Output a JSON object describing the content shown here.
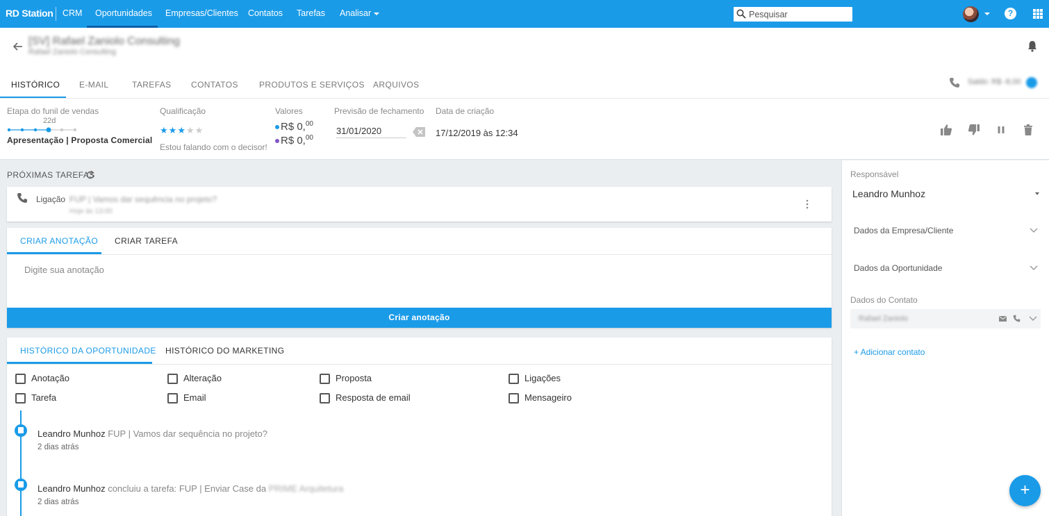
{
  "topbar": {
    "brand": "RD Station",
    "product": "CRM",
    "nav": [
      "Oportunidades",
      "Empresas/Clientes",
      "Contatos",
      "Tarefas",
      "Analisar"
    ],
    "search_placeholder": "Pesquisar",
    "help_label": "?"
  },
  "deal": {
    "title": "[SV] Rafael Zaniolo Consulting",
    "subtitle": "Rafael Zaniolo Consulting"
  },
  "tabs": [
    "HISTÓRICO",
    "E-MAIL",
    "TAREFAS",
    "CONTATOS",
    "PRODUTOS E SERVIÇOS",
    "ARQUIVOS"
  ],
  "saldo": "Saldo: R$ -8,00",
  "summary": {
    "stage_label": "Etapa do funil de vendas",
    "stage_days": "22d",
    "stage_name": "Apresentação | Proposta Comercial",
    "funnel_current_step": 4,
    "funnel_total_steps": 6,
    "qualification_label": "Qualificação",
    "rating": 3,
    "rating_max": 5,
    "qualification_text": "Estou falando com o decisor!",
    "values_label": "Valores",
    "value_one_main": "R$ 0,",
    "value_one_cents": "00",
    "value_two_main": "R$ 0,",
    "value_two_cents": "00",
    "forecast_label": "Previsão de fechamento",
    "forecast_value": "31/01/2020",
    "created_label": "Data de criação",
    "created_value": "17/12/2019 às 12:34"
  },
  "next_tasks": {
    "title": "PRÓXIMAS TAREFAS",
    "task_type": "Ligação",
    "task_text": "FUP | Vamos dar sequência no projeto?",
    "task_sub": "Hoje às 13:00"
  },
  "note": {
    "tab_note": "CRIAR ANOTAÇÃO",
    "tab_task": "CRIAR TAREFA",
    "placeholder": "Digite sua anotação",
    "button": "Criar anotação"
  },
  "history": {
    "tab_deal": "HISTÓRICO DA OPORTUNIDADE",
    "tab_marketing": "HISTÓRICO DO MARKETING",
    "filters": [
      "Anotação",
      "Alteração",
      "Proposta",
      "Ligações",
      "Tarefa",
      "Email",
      "Resposta de email",
      "Mensageiro"
    ],
    "entries": [
      {
        "user": "Leandro Munhoz",
        "text": "FUP | Vamos dar sequência no projeto?",
        "hidden": "",
        "time": "2 dias atrás"
      },
      {
        "user": "Leandro Munhoz",
        "text": "concluiu a tarefa: FUP | Enviar Case da",
        "hidden": "PRIME Arquitetura",
        "time": "2 dias atrás"
      }
    ]
  },
  "sidebar": {
    "owner_label": "Responsável",
    "owner_name": "Leandro Munhoz",
    "company_section": "Dados da Empresa/Cliente",
    "deal_section": "Dados da Oportunidade",
    "contact_label": "Dados do Contato",
    "contact_name": "Rafael Zaniolo",
    "add_contact": "+ Adicionar contato"
  },
  "fab_label": "+",
  "colors": {
    "accent": "#1a9be8",
    "value_dot_one": "#1a9be8",
    "value_dot_two": "#7e57c2"
  }
}
